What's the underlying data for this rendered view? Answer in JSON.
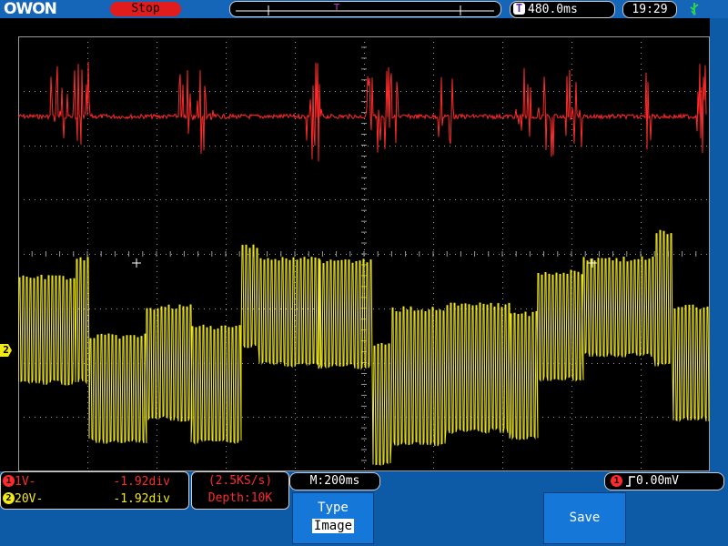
{
  "header": {
    "logo": "OWON",
    "run_status": "Stop",
    "trigger_badge": "T",
    "trigger_position": "480.0ms",
    "clock": "19:29"
  },
  "icons": {
    "usb": "usb-icon",
    "trigger_edge": "rising-edge-icon"
  },
  "channels": [
    {
      "number": "1",
      "scale": "1V",
      "coupling_mark": "-",
      "offset": "-1.92div",
      "color": "#ff2a2a"
    },
    {
      "number": "2",
      "scale": "20V",
      "coupling_mark": "-",
      "offset": "-1.92div",
      "color": "#f2ea16"
    }
  ],
  "sampling": {
    "rate": "(2.5KS/s)",
    "depth": "Depth:10K"
  },
  "timebase": "M:200ms",
  "trigger": {
    "channel": "1",
    "level": "0.00mV"
  },
  "ch2_marker": "2",
  "softkeys": {
    "type_label": "Type",
    "type_value": "Image",
    "save_label": "Save"
  },
  "colors": {
    "background": "#0d5aa6",
    "screen": "#000000",
    "grid": "#9a9a9a",
    "ch1": "#ff2a2a",
    "ch2": "#f2ea16",
    "status_stop": "#e01c1c"
  }
}
